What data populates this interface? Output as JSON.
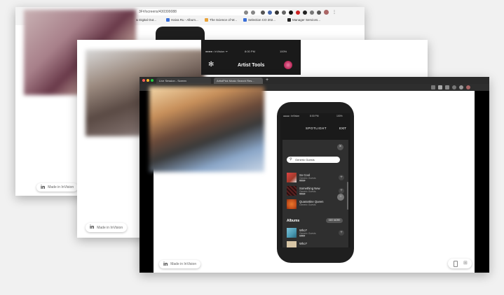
{
  "back_window": {
    "url": "3F#/screens/430399088",
    "bookmarks": [
      "& Digital Out...",
      "Haiva Ru - Album...",
      "The Science of W...",
      "Selection CO 202...",
      "Manager Services..."
    ]
  },
  "middle_window": {
    "phone_status": {
      "carrier": "●●●●○ InVision ᯤ",
      "time": "8:00 PM",
      "battery": "100%"
    },
    "header_title": "Artist Tools"
  },
  "front_window": {
    "tabs": [
      "Live Session - Screen",
      "ArtistPick Music Search Res..."
    ],
    "phone_status": {
      "carrier": "●●●●○ InVision",
      "time": "8:00 PM",
      "battery": "100%"
    },
    "spotlight_label": "SPOTLIGHT",
    "exit_label": "EXIT",
    "search_value": "Generic Guests",
    "rows": [
      {
        "title": "So Cool",
        "sub": "Generic Guests",
        "tag": "SINGLE",
        "color": "#a13a2a"
      },
      {
        "title": "Something New",
        "sub": "Generic Guests",
        "tag": "SINGLE",
        "color": "#4a1c1c"
      },
      {
        "title": "Quarantine Queen",
        "sub": "Generic Guests",
        "tag": "",
        "color": "#c4511c"
      }
    ],
    "albums_heading": "Albums",
    "see_more_label": "SEE MORE",
    "album_rows": [
      {
        "title": "Who?",
        "sub": "Generic Guests",
        "tag": "ALBUM",
        "color": "#4a9ab3"
      },
      {
        "title": "Who?",
        "sub": "",
        "tag": "",
        "color": "#d8c6a6"
      }
    ]
  },
  "made_in_invision_label": "Made in InVision",
  "invision_logo": "in"
}
